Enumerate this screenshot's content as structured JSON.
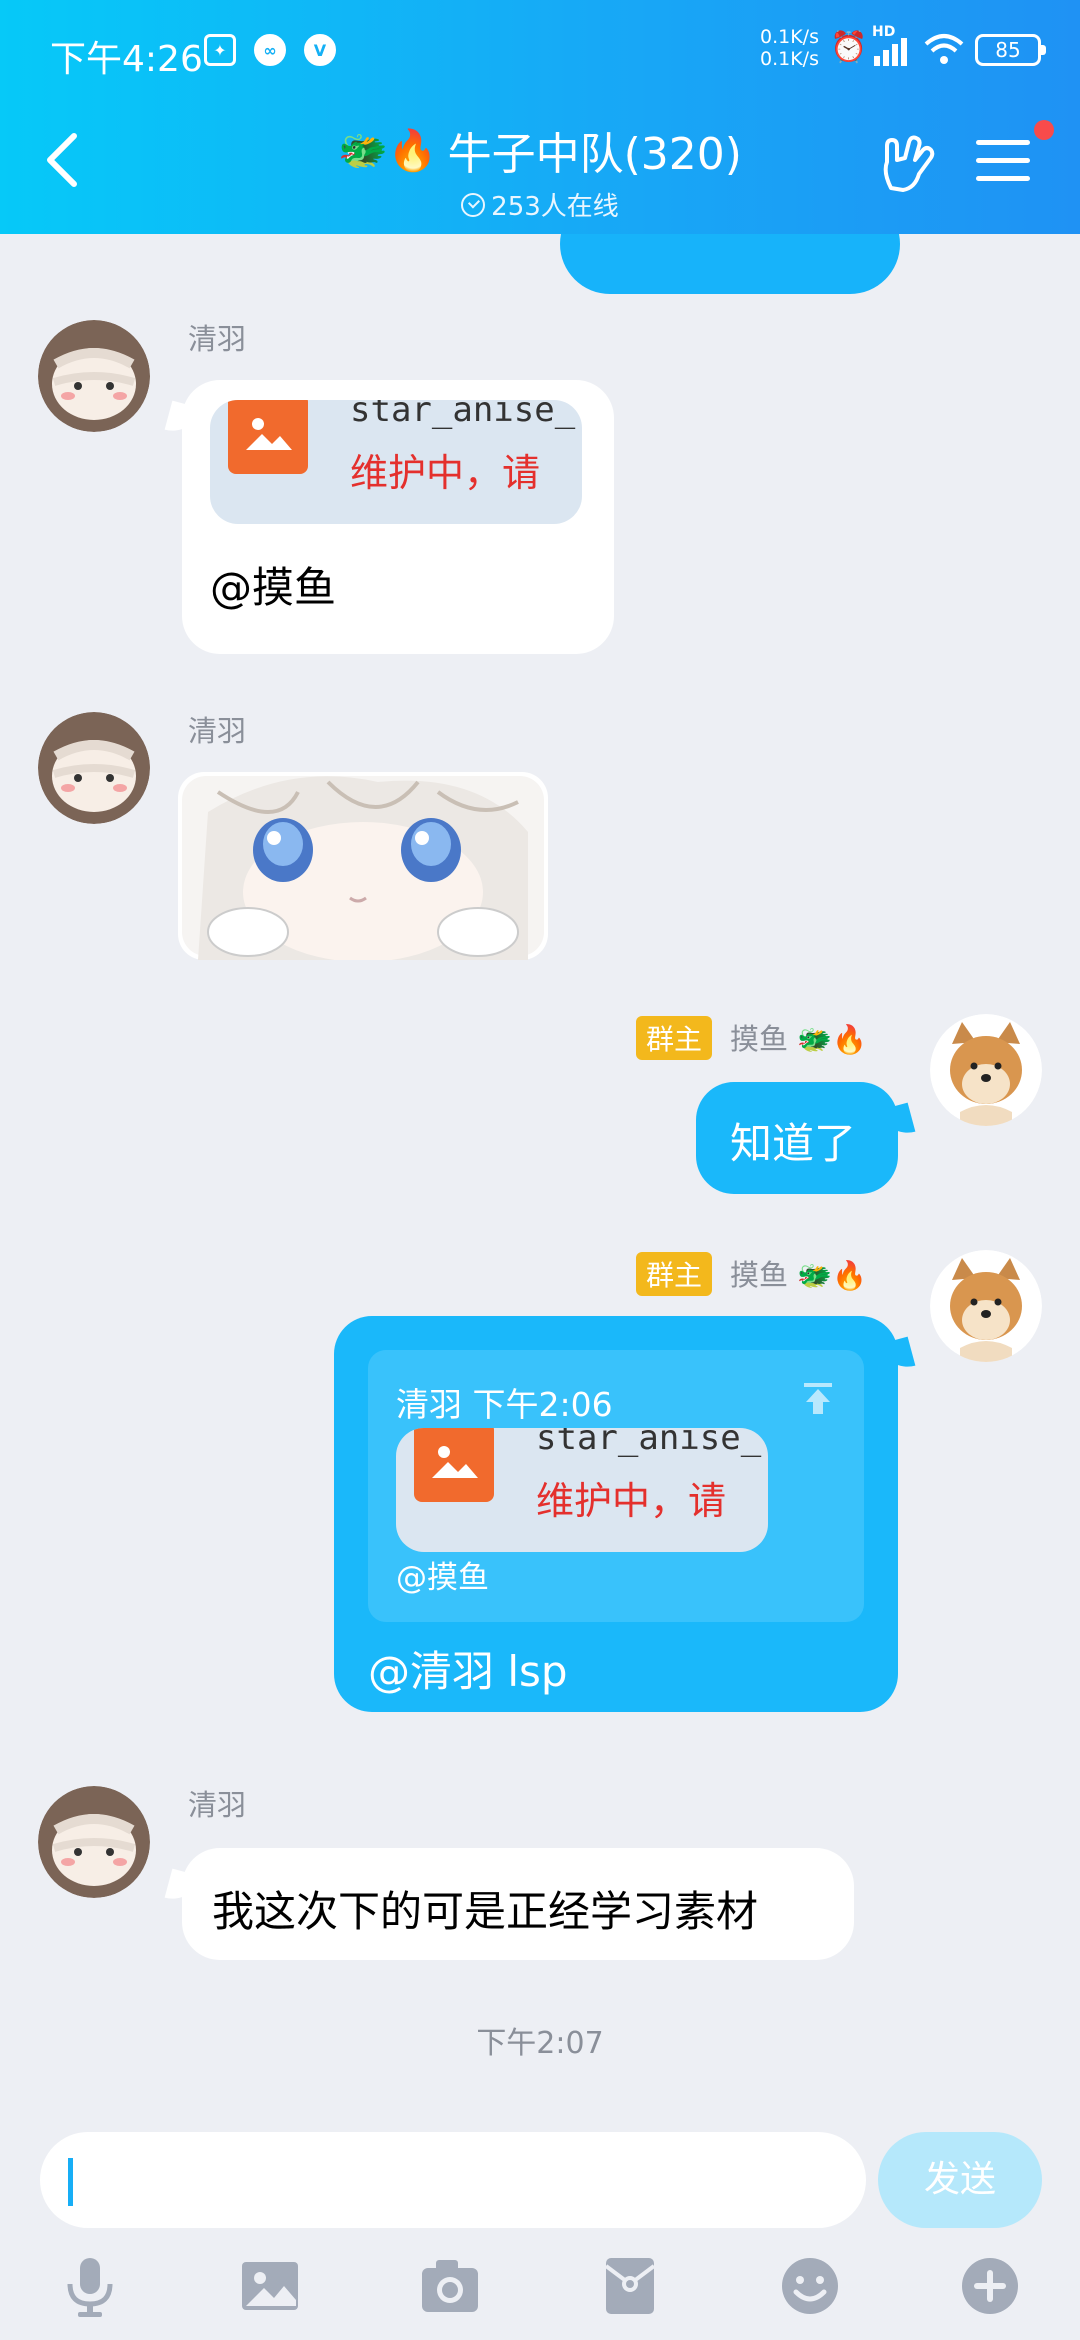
{
  "status_bar": {
    "time": "下午4:26",
    "speed_up": "0.1K/s",
    "speed_down": "0.1K/s",
    "network": "HD",
    "battery": "85"
  },
  "header": {
    "title_emoji": "🐲🔥",
    "title": "牛子中队(320)",
    "online": "253人在线"
  },
  "messages": [
    {
      "sender": "清羽",
      "quoted_image": {
        "line1": "star_anise_",
        "line2": "维护中，请"
      },
      "text": "@摸鱼"
    },
    {
      "sender": "清羽"
    },
    {
      "role": "群主",
      "sender": "摸鱼",
      "name_emoji": "🐲🔥",
      "text": "知道了"
    },
    {
      "role": "群主",
      "sender": "摸鱼",
      "name_emoji": "🐲🔥",
      "quote": {
        "header": "清羽 下午2:06",
        "image": {
          "line1": "star_anise_",
          "line2": "维护中，请"
        },
        "mention": "@摸鱼"
      },
      "text": "@清羽 lsp"
    },
    {
      "sender": "清羽",
      "text": "我这次下的可是正经学习素材"
    }
  ],
  "time_divider": "下午2:07",
  "input": {
    "placeholder": "",
    "send_label": "发送"
  },
  "colors": {
    "header_start": "#06c9f8",
    "header_end": "#1f92f4",
    "my_bubble": "#1ab8fa",
    "badge": "#f3b81c",
    "send_disabled": "#b5e8fb"
  }
}
